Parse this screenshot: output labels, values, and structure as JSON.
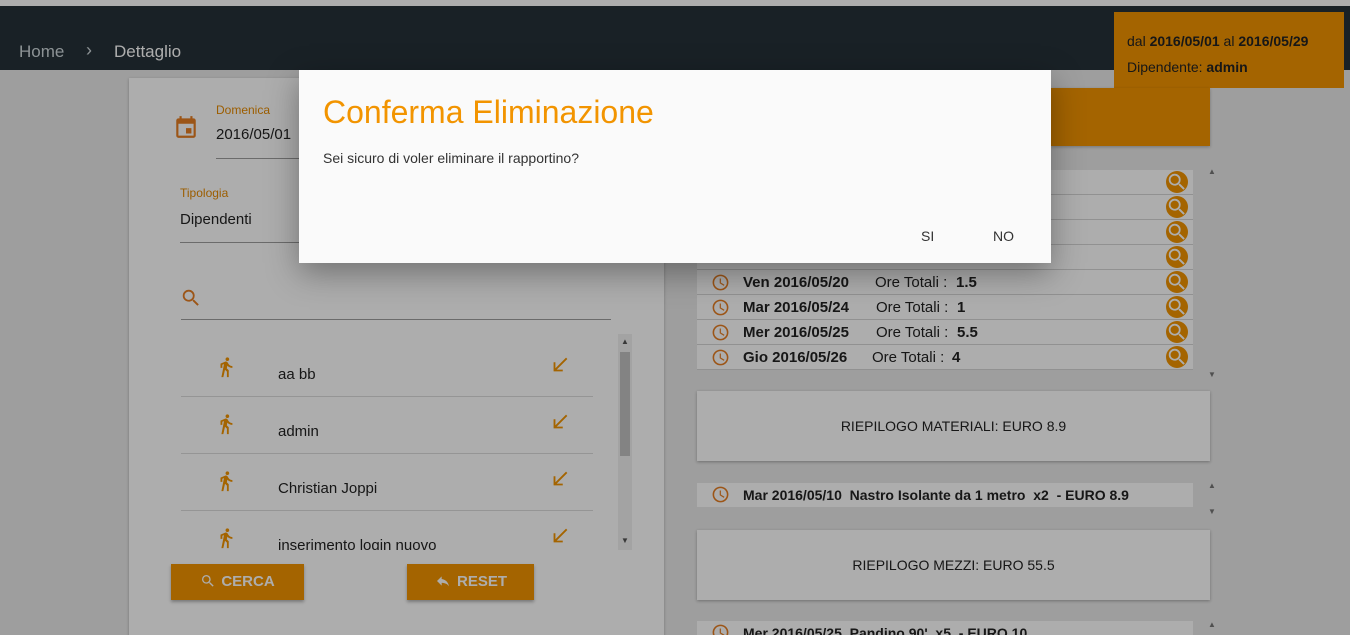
{
  "breadcrumb": {
    "home": "Home",
    "separator": "›",
    "current": "Dettaglio"
  },
  "info": {
    "from_prefix": "dal",
    "from_date": "2016/05/01",
    "to_prefix": "al",
    "to_date": "2016/05/29",
    "employee_label": "Dipendente:",
    "employee": "admin"
  },
  "form": {
    "date_label": "Domenica",
    "date_value": "2016/05/01",
    "type_label": "Tipologia",
    "type_value": "Dipendenti",
    "search_value": ""
  },
  "employees": [
    "aa bb",
    "admin",
    "Christian Joppi",
    "inserimento login nuovo"
  ],
  "buttons": {
    "search": "CERCA",
    "reset": "RESET"
  },
  "reports": [
    {
      "date": "Ven 2016/05/20",
      "label": "Ore Totali :",
      "hours": "1.5"
    },
    {
      "date": "Mar 2016/05/24",
      "label": "Ore Totali :",
      "hours": "1"
    },
    {
      "date": "Mer 2016/05/25",
      "label": "Ore Totali :",
      "hours": "5.5"
    },
    {
      "date": "Gio 2016/05/26",
      "label": "Ore Totali :",
      "hours": "4"
    }
  ],
  "materials": {
    "summary": "RIEPILOGO MATERIALI: EURO 8.9",
    "item": "Mar 2016/05/10  Nastro Isolante da 1 metro  x2  - EURO 8.9"
  },
  "vehicles": {
    "summary": "RIEPILOGO MEZZI: EURO 55.5",
    "item": "Mer 2016/05/25  Pandino 90'  x5  - EURO 10"
  },
  "dialog": {
    "title": "Conferma Eliminazione",
    "message": "Sei sicuro di voler eliminare il rapportino?",
    "yes": "SI",
    "no": "NO"
  },
  "colors": {
    "accent": "#f29400",
    "appbar": "#263238",
    "icon": "#e67e22"
  }
}
